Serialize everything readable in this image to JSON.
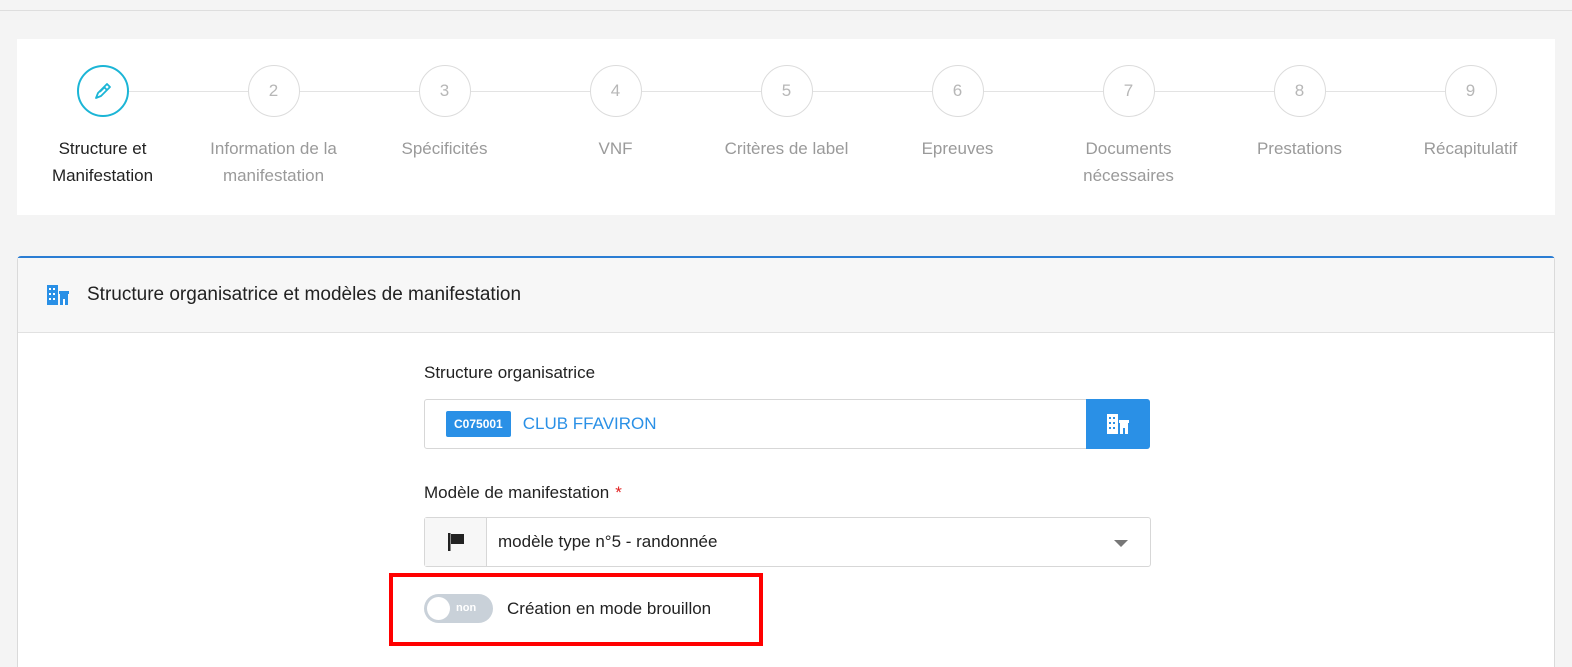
{
  "stepper": {
    "steps": [
      {
        "number": "",
        "label_line1": "Structure et",
        "label_line2": "Manifestation",
        "active": true,
        "icon": "pencil-icon"
      },
      {
        "number": "2",
        "label_line1": "Information de la",
        "label_line2": "manifestation"
      },
      {
        "number": "3",
        "label_line1": "Spécificités",
        "label_line2": ""
      },
      {
        "number": "4",
        "label_line1": "VNF",
        "label_line2": ""
      },
      {
        "number": "5",
        "label_line1": "Critères de label",
        "label_line2": ""
      },
      {
        "number": "6",
        "label_line1": "Epreuves",
        "label_line2": ""
      },
      {
        "number": "7",
        "label_line1": "Documents",
        "label_line2": "nécessaires"
      },
      {
        "number": "8",
        "label_line1": "Prestations",
        "label_line2": ""
      },
      {
        "number": "9",
        "label_line1": "Récapitulatif",
        "label_line2": ""
      }
    ]
  },
  "card": {
    "title": "Structure organisatrice et modèles de manifestation",
    "icon": "building-icon"
  },
  "form": {
    "structure_label": "Structure organisatrice",
    "structure_code": "C075001",
    "structure_name": "CLUB FFAVIRON",
    "model_label": "Modèle de manifestation",
    "model_required": "*",
    "model_value": "modèle type n°5 - randonnée",
    "draft_toggle_state": "non",
    "draft_label": "Création en mode brouillon"
  },
  "colors": {
    "accent": "#2a90e6",
    "active_step": "#1bb5d6",
    "highlight": "#ff0000"
  }
}
